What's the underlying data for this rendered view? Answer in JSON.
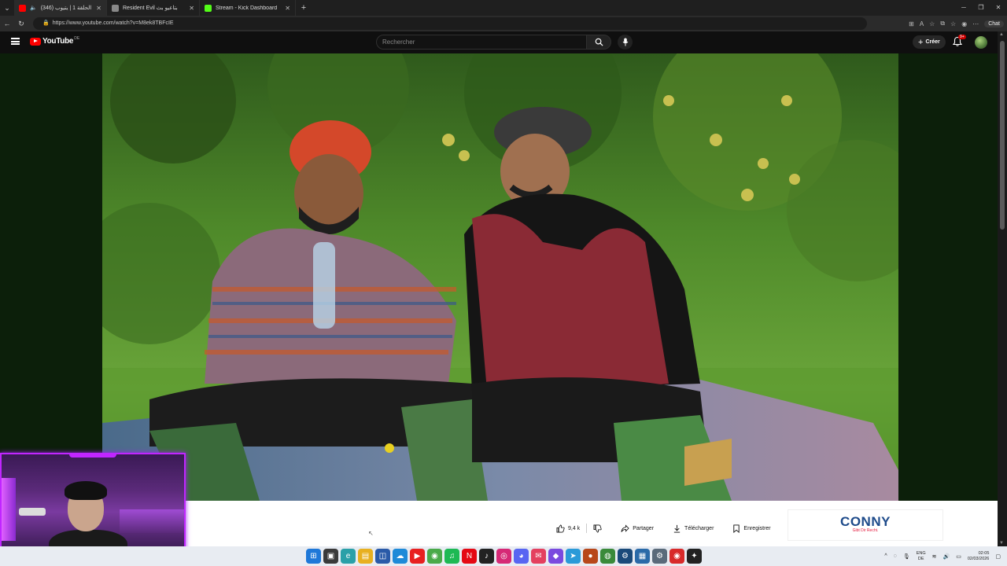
{
  "browser": {
    "tabs": [
      {
        "label": "(346) يلا شوت الحلقة 1 | يتيوب",
        "active": true,
        "icon_color": "#ff0000"
      },
      {
        "label": "Resident Evil بتاعيو بث",
        "active": false,
        "icon_color": "#888888"
      },
      {
        "label": "Stream - Kick Dashboard",
        "active": false,
        "icon_color": "#53fc18"
      }
    ],
    "url": "https://www.youtube.com/watch?v=M8ek8TBFcIE",
    "chat_label": "Chat"
  },
  "youtube": {
    "logo_text": "YouTube",
    "logo_country": "DE",
    "search_placeholder": "Rechercher",
    "create_label": "Créer",
    "notifications_badge": "9+"
  },
  "video_actions": {
    "like_count": "9,4 k",
    "share_label": "Partager",
    "download_label": "Télécharger",
    "save_label": "Enregistrer"
  },
  "ad": {
    "brand": "CONNY",
    "slogan": "Gibt Dir Recht."
  },
  "taskbar": {
    "lang_top": "ENG",
    "lang_bottom": "DE",
    "time": "02:05",
    "date": "02/03/2026"
  },
  "colors": {
    "youtube_red": "#ff0000",
    "cam_border": "#c026ff",
    "kick_green": "#53fc18",
    "conny_blue": "#1d4a8a"
  }
}
